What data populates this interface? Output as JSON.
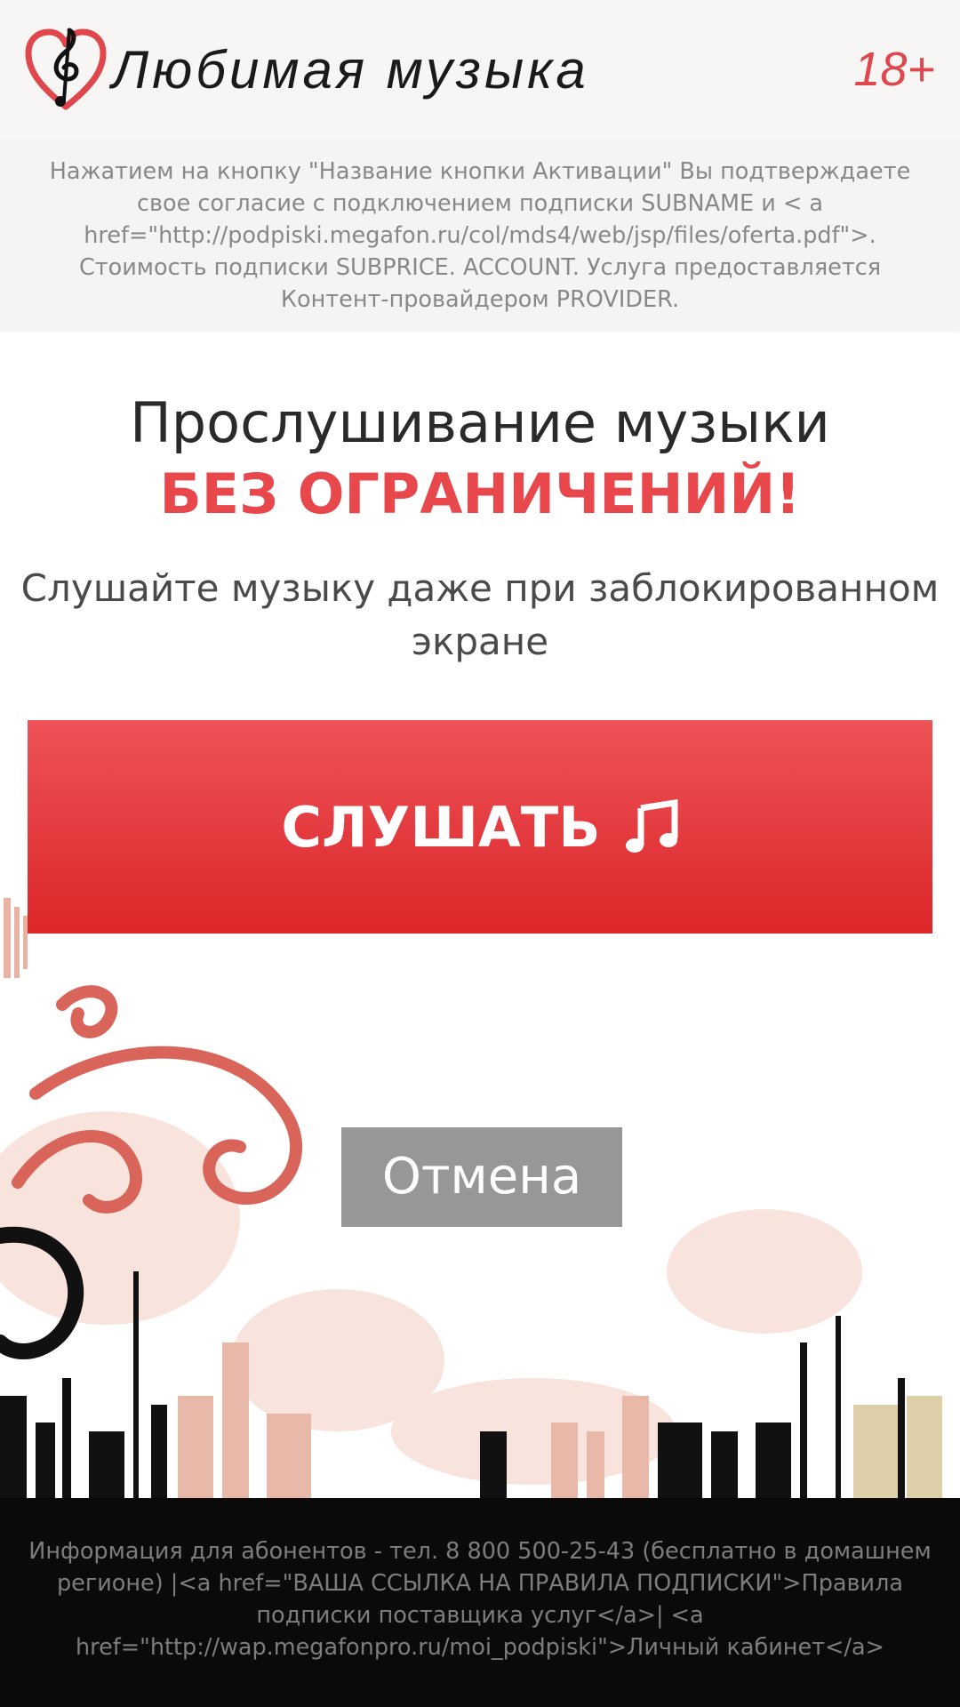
{
  "header": {
    "brand": "Любимая музыка",
    "age_rating": "18+"
  },
  "disclaimer": {
    "text": "Нажатием на кнопку \"Название кнопки Активации\" Вы подтверждаете свое согласие с подключением подписки SUBNAME и < a href=\"http://podpiski.megafon.ru/col/mds4/web/jsp/files/oferta.pdf\">. Стоимость подписки SUBPRICE. ACCOUNT. Услуга предоставляется Контент-провайдером PROVIDER."
  },
  "main": {
    "headline": "Прослушивание музыки",
    "headline_accent": "БЕЗ ОГРАНИЧЕНИЙ!",
    "subline": "Слушайте музыку даже при заблокированном экране",
    "listen_label": "СЛУШАТЬ",
    "cancel_label": "Отмена"
  },
  "footer": {
    "text": "Информация для абонентов - тел. 8 800 500-25-43 (бесплатно в домашнем регионе) |<a href=\"ВАША ССЫЛКА НА ПРАВИЛА ПОДПИСКИ\">Правила подписки поставщика услуг</a>| <a href=\"http://wap.megafonpro.ru/moi_podpiski\">Личный кабинет</a>"
  },
  "icons": {
    "logo": "heart-treble-clef-icon",
    "listen": "music-note-icon"
  },
  "colors": {
    "accent": "#e8474c",
    "button_top": "#ee5357",
    "button_bottom": "#de2628",
    "cancel": "#979797",
    "footer_bg": "#0a0a0a"
  }
}
